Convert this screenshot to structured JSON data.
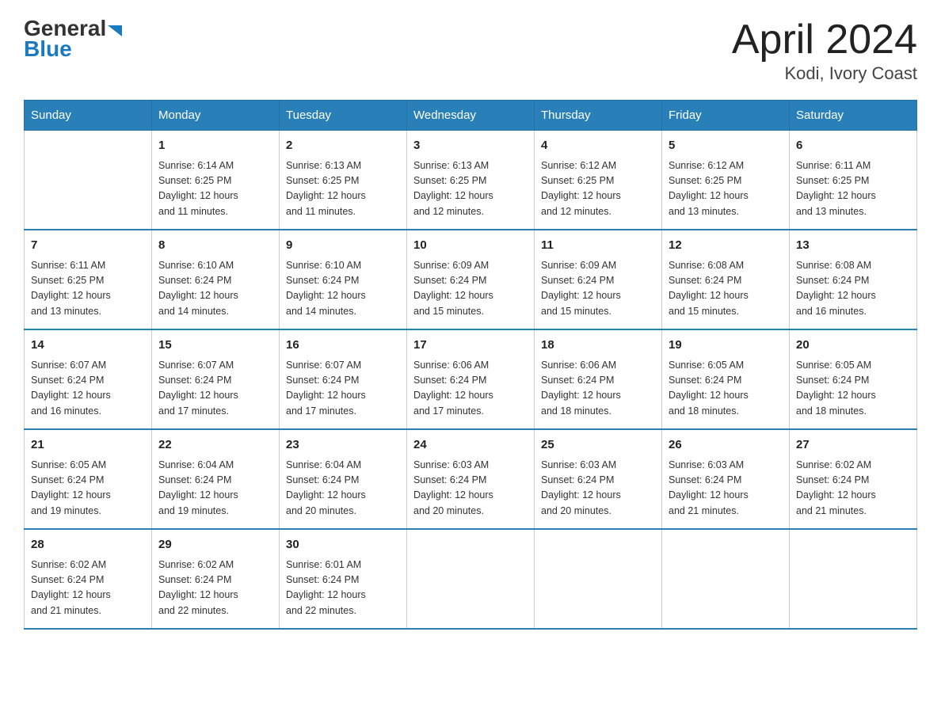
{
  "logo": {
    "text_general": "General",
    "text_blue": "Blue",
    "triangle": "▶"
  },
  "title": "April 2024",
  "subtitle": "Kodi, Ivory Coast",
  "days_of_week": [
    "Sunday",
    "Monday",
    "Tuesday",
    "Wednesday",
    "Thursday",
    "Friday",
    "Saturday"
  ],
  "weeks": [
    [
      {
        "day": "",
        "info": ""
      },
      {
        "day": "1",
        "info": "Sunrise: 6:14 AM\nSunset: 6:25 PM\nDaylight: 12 hours\nand 11 minutes."
      },
      {
        "day": "2",
        "info": "Sunrise: 6:13 AM\nSunset: 6:25 PM\nDaylight: 12 hours\nand 11 minutes."
      },
      {
        "day": "3",
        "info": "Sunrise: 6:13 AM\nSunset: 6:25 PM\nDaylight: 12 hours\nand 12 minutes."
      },
      {
        "day": "4",
        "info": "Sunrise: 6:12 AM\nSunset: 6:25 PM\nDaylight: 12 hours\nand 12 minutes."
      },
      {
        "day": "5",
        "info": "Sunrise: 6:12 AM\nSunset: 6:25 PM\nDaylight: 12 hours\nand 13 minutes."
      },
      {
        "day": "6",
        "info": "Sunrise: 6:11 AM\nSunset: 6:25 PM\nDaylight: 12 hours\nand 13 minutes."
      }
    ],
    [
      {
        "day": "7",
        "info": "Sunrise: 6:11 AM\nSunset: 6:25 PM\nDaylight: 12 hours\nand 13 minutes."
      },
      {
        "day": "8",
        "info": "Sunrise: 6:10 AM\nSunset: 6:24 PM\nDaylight: 12 hours\nand 14 minutes."
      },
      {
        "day": "9",
        "info": "Sunrise: 6:10 AM\nSunset: 6:24 PM\nDaylight: 12 hours\nand 14 minutes."
      },
      {
        "day": "10",
        "info": "Sunrise: 6:09 AM\nSunset: 6:24 PM\nDaylight: 12 hours\nand 15 minutes."
      },
      {
        "day": "11",
        "info": "Sunrise: 6:09 AM\nSunset: 6:24 PM\nDaylight: 12 hours\nand 15 minutes."
      },
      {
        "day": "12",
        "info": "Sunrise: 6:08 AM\nSunset: 6:24 PM\nDaylight: 12 hours\nand 15 minutes."
      },
      {
        "day": "13",
        "info": "Sunrise: 6:08 AM\nSunset: 6:24 PM\nDaylight: 12 hours\nand 16 minutes."
      }
    ],
    [
      {
        "day": "14",
        "info": "Sunrise: 6:07 AM\nSunset: 6:24 PM\nDaylight: 12 hours\nand 16 minutes."
      },
      {
        "day": "15",
        "info": "Sunrise: 6:07 AM\nSunset: 6:24 PM\nDaylight: 12 hours\nand 17 minutes."
      },
      {
        "day": "16",
        "info": "Sunrise: 6:07 AM\nSunset: 6:24 PM\nDaylight: 12 hours\nand 17 minutes."
      },
      {
        "day": "17",
        "info": "Sunrise: 6:06 AM\nSunset: 6:24 PM\nDaylight: 12 hours\nand 17 minutes."
      },
      {
        "day": "18",
        "info": "Sunrise: 6:06 AM\nSunset: 6:24 PM\nDaylight: 12 hours\nand 18 minutes."
      },
      {
        "day": "19",
        "info": "Sunrise: 6:05 AM\nSunset: 6:24 PM\nDaylight: 12 hours\nand 18 minutes."
      },
      {
        "day": "20",
        "info": "Sunrise: 6:05 AM\nSunset: 6:24 PM\nDaylight: 12 hours\nand 18 minutes."
      }
    ],
    [
      {
        "day": "21",
        "info": "Sunrise: 6:05 AM\nSunset: 6:24 PM\nDaylight: 12 hours\nand 19 minutes."
      },
      {
        "day": "22",
        "info": "Sunrise: 6:04 AM\nSunset: 6:24 PM\nDaylight: 12 hours\nand 19 minutes."
      },
      {
        "day": "23",
        "info": "Sunrise: 6:04 AM\nSunset: 6:24 PM\nDaylight: 12 hours\nand 20 minutes."
      },
      {
        "day": "24",
        "info": "Sunrise: 6:03 AM\nSunset: 6:24 PM\nDaylight: 12 hours\nand 20 minutes."
      },
      {
        "day": "25",
        "info": "Sunrise: 6:03 AM\nSunset: 6:24 PM\nDaylight: 12 hours\nand 20 minutes."
      },
      {
        "day": "26",
        "info": "Sunrise: 6:03 AM\nSunset: 6:24 PM\nDaylight: 12 hours\nand 21 minutes."
      },
      {
        "day": "27",
        "info": "Sunrise: 6:02 AM\nSunset: 6:24 PM\nDaylight: 12 hours\nand 21 minutes."
      }
    ],
    [
      {
        "day": "28",
        "info": "Sunrise: 6:02 AM\nSunset: 6:24 PM\nDaylight: 12 hours\nand 21 minutes."
      },
      {
        "day": "29",
        "info": "Sunrise: 6:02 AM\nSunset: 6:24 PM\nDaylight: 12 hours\nand 22 minutes."
      },
      {
        "day": "30",
        "info": "Sunrise: 6:01 AM\nSunset: 6:24 PM\nDaylight: 12 hours\nand 22 minutes."
      },
      {
        "day": "",
        "info": ""
      },
      {
        "day": "",
        "info": ""
      },
      {
        "day": "",
        "info": ""
      },
      {
        "day": "",
        "info": ""
      }
    ]
  ]
}
